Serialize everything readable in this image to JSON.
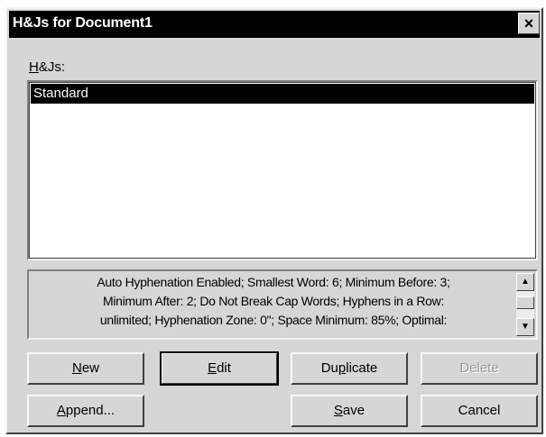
{
  "window": {
    "title": "H&Js for Document1",
    "close_glyph": "×"
  },
  "hjs_label": {
    "accel": "H",
    "rest": "&Js:"
  },
  "hjs_list": {
    "items": [
      "Standard"
    ],
    "selected_index": 0
  },
  "description": {
    "lines": [
      "Auto Hyphenation Enabled;  Smallest Word: 6;  Minimum Before: 3;",
      "Minimum After: 2;  Do Not Break Cap Words;  Hyphens in a Row:",
      "unlimited;  Hyphenation Zone: 0\";  Space Minimum: 85%;  Optimal:"
    ],
    "scroll_up_glyph": "▲",
    "scroll_down_glyph": "▼"
  },
  "buttons": {
    "new": {
      "accel": "N",
      "rest": "ew"
    },
    "edit": {
      "accel": "E",
      "rest": "dit"
    },
    "duplicate": {
      "pre": "Du",
      "accel": "p",
      "rest": "licate"
    },
    "delete": {
      "label": "Delete"
    },
    "append": {
      "accel": "A",
      "rest": "ppend..."
    },
    "save": {
      "accel": "S",
      "rest": "ave"
    },
    "cancel": {
      "label": "Cancel"
    }
  }
}
